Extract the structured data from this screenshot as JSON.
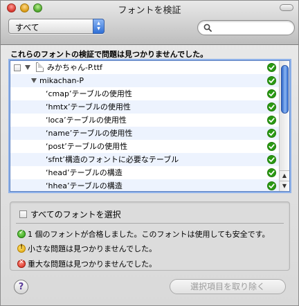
{
  "window": {
    "title": "フォントを検証"
  },
  "toolbar": {
    "filter_selected": "すべて"
  },
  "status_message": "これらのフォントの検証で問題は見つかりませんでした。",
  "list": {
    "font_file": "みかちゃん-P.ttf",
    "font_name": "mikachan-P",
    "checks": [
      "‘cmap’テーブルの使用性",
      "‘hmtx’テーブルの使用性",
      "‘loca’テーブルの使用性",
      "‘name’テーブルの使用性",
      "‘post’テーブルの使用性",
      "‘sfnt’構造のフォントに必要なテーブル",
      "‘head’テーブルの構造",
      "‘hhea’テーブルの構造"
    ]
  },
  "panel": {
    "select_all_label": "すべてのフォントを選択",
    "passed_text": "1 個のフォントが合格しました。このフォントは使用しても安全です。",
    "minor_text": "小さな問題は見つかりませんでした。",
    "major_text": "重大な問題は見つかりませんでした。"
  },
  "buttons": {
    "help": "?",
    "remove": "選択項目を取り除く"
  },
  "colors": {
    "ok": "#2a9a12",
    "warn": "#dca30a",
    "error": "#d2281b",
    "focus_ring": "#8fb2ea",
    "row_alt": "#edf3fe"
  }
}
